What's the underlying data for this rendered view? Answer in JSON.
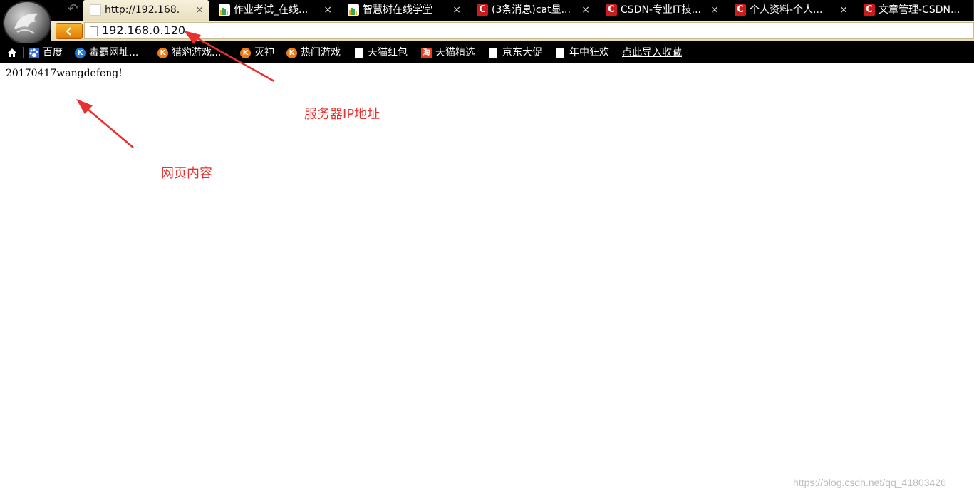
{
  "tabs": [
    {
      "title": "http://192.168.",
      "icon": "page-icon",
      "active": true
    },
    {
      "title": "作业考试_在线...",
      "icon": "zhihuishu-icon",
      "active": false
    },
    {
      "title": "智慧树在线学堂",
      "icon": "zhihuishu-icon",
      "active": false
    },
    {
      "title": "(3条消息)cat显...",
      "icon": "csdn-icon",
      "active": false
    },
    {
      "title": "CSDN-专业IT技...",
      "icon": "csdn-icon",
      "active": false
    },
    {
      "title": "个人资料-个人...",
      "icon": "csdn-icon",
      "active": false
    },
    {
      "title": "文章管理-CSDN...",
      "icon": "csdn-icon",
      "active": false
    }
  ],
  "tab_close_glyph": "×",
  "csdn_icon_letter": "C",
  "address": {
    "value": "192.168.0.120"
  },
  "bookmarks": [
    {
      "label": "百度",
      "icon": "baidu-icon"
    },
    {
      "label": "毒霸网址...",
      "icon": "k-icon"
    },
    {
      "label": "猎豹游戏...",
      "icon": "liebao-icon"
    },
    {
      "label": "灭神",
      "icon": "liebao-icon"
    },
    {
      "label": "热门游戏",
      "icon": "liebao-icon"
    },
    {
      "label": "天猫红包",
      "icon": "page-icon"
    },
    {
      "label": "天猫精选",
      "icon": "tmall-icon"
    },
    {
      "label": "京东大促",
      "icon": "page-icon"
    },
    {
      "label": "年中狂欢",
      "icon": "page-icon"
    }
  ],
  "bookmark_icon_letters": {
    "k": "K",
    "liebao": "K",
    "tmall": "淘"
  },
  "bookmark_import_label": "点此导入收藏",
  "page_text": "20170417wangdefeng!",
  "annotations": {
    "server_ip": "服务器IP地址",
    "page_content": "网页内容"
  },
  "watermark": "https://blog.csdn.net/qq_41803426",
  "colors": {
    "annotation": "#e8302f",
    "back_button": "#f0960e",
    "csdn_red": "#cc1b1b"
  }
}
